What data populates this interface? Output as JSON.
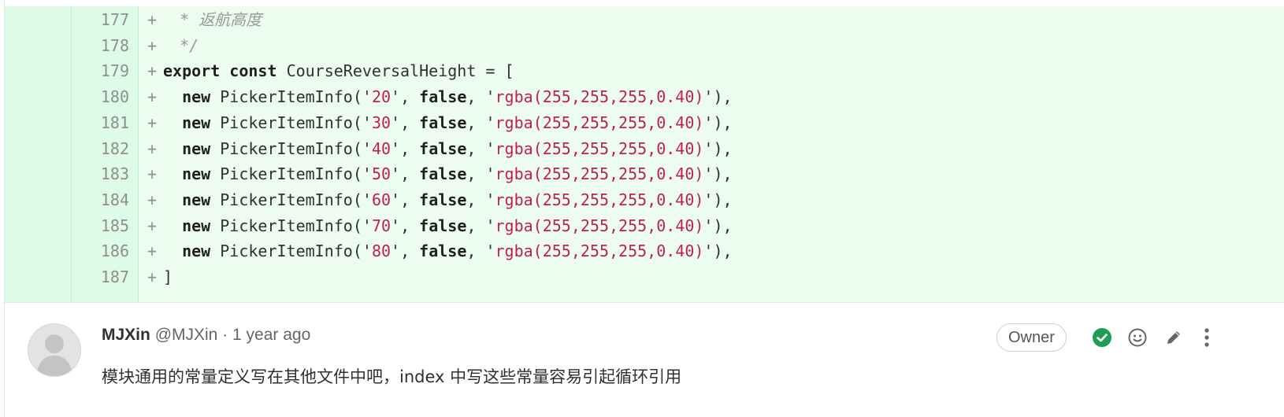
{
  "diff": {
    "lines": [
      {
        "num": "177",
        "marker": "+",
        "kind": "comment",
        "text": " * 返航高度"
      },
      {
        "num": "178",
        "marker": "+",
        "kind": "comment",
        "text": " */"
      },
      {
        "num": "179",
        "marker": "+",
        "kind": "decl",
        "kw1": "export",
        "kw2": "const",
        "ident": "CourseReversalHeight",
        "rest": " = ["
      },
      {
        "num": "180",
        "marker": "+",
        "kind": "item",
        "value": "20",
        "flag": "false",
        "color": "rgba(255,255,255,0.40)"
      },
      {
        "num": "181",
        "marker": "+",
        "kind": "item",
        "value": "30",
        "flag": "false",
        "color": "rgba(255,255,255,0.40)"
      },
      {
        "num": "182",
        "marker": "+",
        "kind": "item",
        "value": "40",
        "flag": "false",
        "color": "rgba(255,255,255,0.40)"
      },
      {
        "num": "183",
        "marker": "+",
        "kind": "item",
        "value": "50",
        "flag": "false",
        "color": "rgba(255,255,255,0.40)"
      },
      {
        "num": "184",
        "marker": "+",
        "kind": "item",
        "value": "60",
        "flag": "false",
        "color": "rgba(255,255,255,0.40)"
      },
      {
        "num": "185",
        "marker": "+",
        "kind": "item",
        "value": "70",
        "flag": "false",
        "color": "rgba(255,255,255,0.40)"
      },
      {
        "num": "186",
        "marker": "+",
        "kind": "item",
        "value": "80",
        "flag": "false",
        "color": "rgba(255,255,255,0.40)"
      },
      {
        "num": "187",
        "marker": "+",
        "kind": "close",
        "text": "]"
      }
    ],
    "item_kw": "new",
    "item_ctor": "PickerItemInfo"
  },
  "note": {
    "author_name": "MJXin",
    "author_handle": "@MJXin",
    "separator": "·",
    "time": "1 year ago",
    "role_badge": "Owner",
    "body": "模块通用的常量定义写在其他文件中吧，index 中写这些常量容易引起循环引用",
    "icons": [
      "resolve-check-icon",
      "emoji-icon",
      "edit-pencil-icon",
      "more-vertical-icon"
    ]
  },
  "colors": {
    "added_bg": "#ecfdf0",
    "gutter_bg": "#ddfbe6",
    "string": "#c21e56",
    "resolved_green": "#1f9d55"
  }
}
